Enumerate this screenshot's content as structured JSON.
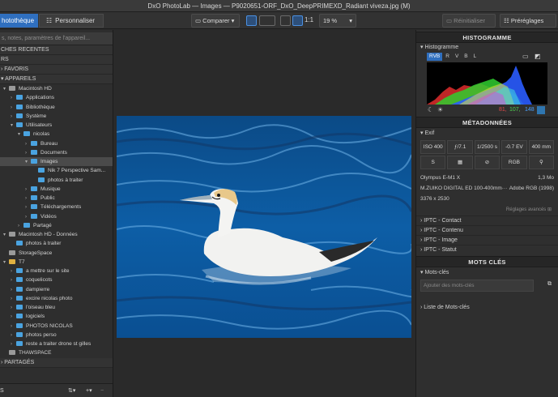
{
  "window": {
    "title": "DxO PhotoLab — Images — P9020651-ORF_DxO_DeepPRIMEXD_Radiant viveza.jpg (M)"
  },
  "toolbar": {
    "tab_photo": "hotothèque",
    "tab_custom": "Personnaliser",
    "compare": "Comparer",
    "ratio": "1:1",
    "zoom": "19 %",
    "reset": "Réinitialiser",
    "presets": "Préréglages"
  },
  "sidebar": {
    "search_placeholder": "s, notes, paramètres de l'appareil...",
    "recent_searches": "CHES RECENTES",
    "section_rs": "RS",
    "favorites": "FAVORIS",
    "devices": "APPAREILS",
    "tree": [
      {
        "label": "Macintosh HD",
        "indent": 0,
        "chev": "▾",
        "icon": "disk"
      },
      {
        "label": "Applications",
        "indent": 1,
        "chev": "›",
        "icon": "folder"
      },
      {
        "label": "Bibliothèque",
        "indent": 1,
        "chev": "›",
        "icon": "folder"
      },
      {
        "label": "Système",
        "indent": 1,
        "chev": "›",
        "icon": "folder"
      },
      {
        "label": "Utilisateurs",
        "indent": 1,
        "chev": "▾",
        "icon": "folder"
      },
      {
        "label": "nicolas",
        "indent": 2,
        "chev": "▾",
        "icon": "folder"
      },
      {
        "label": "Bureau",
        "indent": 3,
        "chev": "›",
        "icon": "folder"
      },
      {
        "label": "Documents",
        "indent": 3,
        "chev": "›",
        "icon": "folder"
      },
      {
        "label": "Images",
        "indent": 3,
        "chev": "▾",
        "icon": "folder",
        "selected": true
      },
      {
        "label": "Nik 7 Perspective Sam...",
        "indent": 4,
        "chev": "",
        "icon": "folder"
      },
      {
        "label": "photos à traiter",
        "indent": 4,
        "chev": "",
        "icon": "folder"
      },
      {
        "label": "Musique",
        "indent": 3,
        "chev": "›",
        "icon": "folder"
      },
      {
        "label": "Public",
        "indent": 3,
        "chev": "›",
        "icon": "folder"
      },
      {
        "label": "Téléchargements",
        "indent": 3,
        "chev": "›",
        "icon": "folder"
      },
      {
        "label": "Vidéos",
        "indent": 3,
        "chev": "›",
        "icon": "folder"
      },
      {
        "label": "Partagé",
        "indent": 2,
        "chev": "›",
        "icon": "folder"
      },
      {
        "label": "Macintosh HD - Données",
        "indent": 0,
        "chev": "▾",
        "icon": "disk"
      },
      {
        "label": "photos à traiter",
        "indent": 1,
        "chev": "",
        "icon": "folder"
      },
      {
        "label": "StorageSpace",
        "indent": 0,
        "chev": "",
        "icon": "disk"
      },
      {
        "label": "T7",
        "indent": 0,
        "chev": "▾",
        "icon": "disk-yellow"
      },
      {
        "label": "a mettre sur le site",
        "indent": 1,
        "chev": "›",
        "icon": "folder"
      },
      {
        "label": "coquelicots",
        "indent": 1,
        "chev": "›",
        "icon": "folder"
      },
      {
        "label": "dampierre",
        "indent": 1,
        "chev": "›",
        "icon": "folder"
      },
      {
        "label": "excire nicolas photo",
        "indent": 1,
        "chev": "›",
        "icon": "folder"
      },
      {
        "label": "l'oiseau bleu",
        "indent": 1,
        "chev": "›",
        "icon": "folder"
      },
      {
        "label": "logiciels",
        "indent": 1,
        "chev": "›",
        "icon": "folder"
      },
      {
        "label": "PHOTOS NICOLAS",
        "indent": 1,
        "chev": "›",
        "icon": "folder"
      },
      {
        "label": "photos perso",
        "indent": 1,
        "chev": "›",
        "icon": "folder"
      },
      {
        "label": "reste a traiter drone st gilles",
        "indent": 1,
        "chev": "›",
        "icon": "folder"
      },
      {
        "label": "THAWSPACE",
        "indent": 0,
        "chev": "",
        "icon": "disk"
      }
    ],
    "shared": "PARTAGÉS",
    "footer_label": "S"
  },
  "histogram": {
    "title": "HISTOGRAMME",
    "subtitle": "Histogramme",
    "channels": [
      "RVB",
      "R",
      "V",
      "B",
      "L"
    ],
    "r": "81,",
    "g": "107,",
    "b": "148"
  },
  "metadata": {
    "title": "MÉTADONNÉES",
    "exif": "Exif",
    "chips": [
      "ISO 400",
      "ƒ/7.1",
      "1/2500 s",
      "-0.7 EV",
      "400 mm"
    ],
    "chips2": [
      "S",
      "▦",
      "⊘",
      "RGB",
      "⚲"
    ],
    "camera": "Olympus E-M1 X",
    "size": "1,3 Mo",
    "lens": "M.ZUIKO DIGITAL ED 100-400mm···",
    "color_space": "Adobe RGB (1998)",
    "dimensions": "3376 x 2530",
    "advanced": "Réglages avancés",
    "iptc": [
      "IPTC - Contact",
      "IPTC - Contenu",
      "IPTC - Image",
      "IPTC - Statut"
    ]
  },
  "keywords": {
    "title": "MOTS CLÉS",
    "sub": "Mots-clés",
    "placeholder": "Ajouter des mots-clés",
    "list": "Liste de Mots-clés"
  }
}
